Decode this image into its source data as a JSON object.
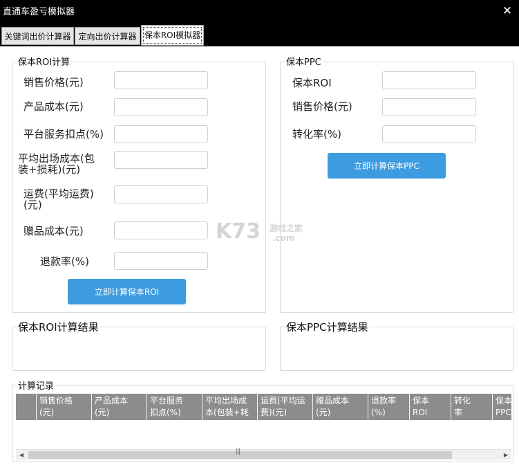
{
  "window": {
    "title": "直通车盈亏模拟器",
    "close_glyph": "✕"
  },
  "tabs": [
    {
      "label": "关键词出价计算器"
    },
    {
      "label": "定向出价计算器"
    },
    {
      "label": "保本ROI模拟器"
    }
  ],
  "roi_group": {
    "legend": "保本ROI计算",
    "fields": [
      {
        "label": "销售价格(元)",
        "value": ""
      },
      {
        "label": "产品成本(元)",
        "value": ""
      },
      {
        "label": "平台服务扣点(%)",
        "value": ""
      },
      {
        "label": "平均出场成本(包装+损耗)(元)",
        "label_line1": "平均出场成本(包",
        "label_line2": "装+损耗)(元)",
        "value": ""
      },
      {
        "label": "运费(平均运费)(元)",
        "label_line1": "运费(平均运费)",
        "label_line2": "(元)",
        "value": ""
      },
      {
        "label": "赠品成本(元)",
        "value": ""
      },
      {
        "label": "退款率(%)",
        "value": ""
      }
    ],
    "button": "立即计算保本ROI"
  },
  "ppc_group": {
    "legend": "保本PPC",
    "fields": [
      {
        "label": "保本ROI",
        "value": ""
      },
      {
        "label": "销售价格(元)",
        "value": ""
      },
      {
        "label": "转化率(%)",
        "value": ""
      }
    ],
    "button": "立即计算保本PPC"
  },
  "roi_result": {
    "legend": "保本ROI计算结果",
    "value": ""
  },
  "ppc_result": {
    "legend": "保本PPC计算结果",
    "value": ""
  },
  "records": {
    "legend": "计算记录",
    "columns": [
      {
        "line1": "销售价格",
        "line2": "(元)"
      },
      {
        "line1": "产品成本",
        "line2": "(元)"
      },
      {
        "line1": "平台服务",
        "line2": "扣点(%)"
      },
      {
        "line1": "平均出场成",
        "line2": "本(包装+耗"
      },
      {
        "line1": "运费(平均运",
        "line2": "费)(元)"
      },
      {
        "line1": "赠品成本",
        "line2": "(元)"
      },
      {
        "line1": "退款率",
        "line2": "(%)"
      },
      {
        "line1": "保本",
        "line2": "ROI"
      },
      {
        "line1": "转化",
        "line2": "率"
      },
      {
        "line1": "保本",
        "line2": "PPC"
      }
    ],
    "rows": [],
    "scrollbar": {
      "left_arrow": "◀",
      "right_arrow": "▶",
      "grip": "|||"
    }
  },
  "watermark": {
    "text": "K73 游戏之家 .com"
  }
}
